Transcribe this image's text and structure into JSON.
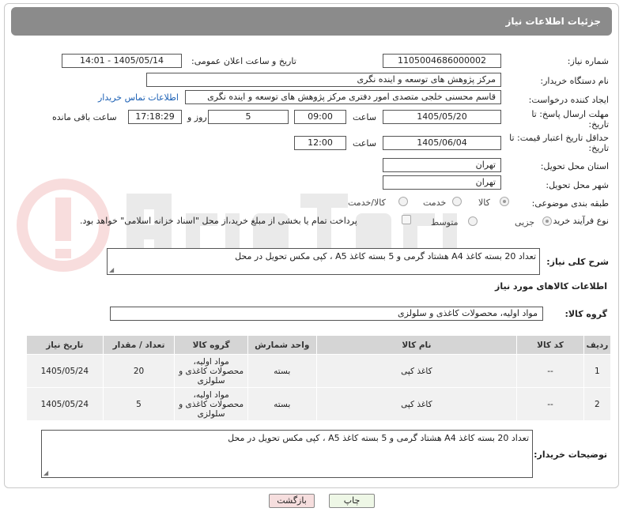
{
  "header": {
    "title": "جزئیات اطلاعات نیاز"
  },
  "form": {
    "need_number_label": "شماره نیاز:",
    "need_number": "1105004686000002",
    "announce_label": "تاریخ و ساعت اعلان عمومی:",
    "announce_value": "1405/05/14 - 14:01",
    "buyer_org_label": "نام دستگاه خریدار:",
    "buyer_org": "مرکز پژوهش های توسعه و اینده نگری",
    "creator_label": "ایجاد کننده درخواست:",
    "creator": "قاسم محسنی خلجی متصدی امور دفتری مرکز پژوهش های توسعه و اینده نگری",
    "contact_link": "اطلاعات تماس خریدار",
    "send_deadline_label": "مهلت ارسال پاسخ: تا تاریخ:",
    "send_date": "1405/05/20",
    "time_label": "ساعت",
    "send_time": "09:00",
    "days_value": "5",
    "days_label": "روز و",
    "remaining_time": "17:18:29",
    "remaining_label": "ساعت باقی مانده",
    "validity_label": "حداقل تاریخ اعتبار قیمت: تا تاریخ:",
    "validity_date": "1405/06/04",
    "validity_time": "12:00",
    "province_label": "استان محل تحویل:",
    "province": "تهران",
    "city_label": "شهر محل تحویل:",
    "city": "تهران",
    "category_label": "طبقه بندی موضوعی:",
    "category_options": [
      "کالا",
      "خدمت",
      "کالا/خدمت"
    ],
    "process_label": "نوع فرآیند خرید :",
    "process_options": [
      "جزیی",
      "متوسط"
    ],
    "payment_note": "پرداخت تمام یا بخشی از مبلغ خرید،از محل \"اسناد خزانه اسلامی\" خواهد بود."
  },
  "description": {
    "label": "شرح کلی نیاز:",
    "text": "تعداد 20 بسته کاغذ A4 هشتاد گرمی و 5 بسته کاغذ A5 ، کپی مکس  تحویل در محل"
  },
  "goods": {
    "section_title": "اطلاعات کالاهای مورد نیاز",
    "group_label": "گروه کالا:",
    "group_value": "مواد اولیه، محصولات کاغذی و سلولزی",
    "columns": [
      "ردیف",
      "کد کالا",
      "نام کالا",
      "واحد شمارش",
      "گروه کالا",
      "تعداد / مقدار",
      "تاریخ نیاز"
    ],
    "rows": [
      {
        "row": "1",
        "code": "--",
        "name": "کاغذ کپی",
        "unit": "بسته",
        "group": "مواد اولیه، محصولات کاغذی و سلولزی",
        "qty": "20",
        "date": "1405/05/24"
      },
      {
        "row": "2",
        "code": "--",
        "name": "کاغذ کپی",
        "unit": "بسته",
        "group": "مواد اولیه، محصولات کاغذی و سلولزی",
        "qty": "5",
        "date": "1405/05/24"
      }
    ]
  },
  "buyer_notes": {
    "label": "توضیحات خریدار:",
    "text": "تعداد 20 بسته کاغذ A4 هشتاد گرمی و 5 بسته کاغذ A5 ، کپی مکس  تحویل در محل"
  },
  "buttons": {
    "print": "چاپ",
    "back": "بازگشت"
  },
  "colors": {
    "header_bg": "#8b8b8b",
    "back_button_bg": "#f6dede",
    "print_button_bg": "#eef7e6",
    "link": "#1a5fb4"
  }
}
